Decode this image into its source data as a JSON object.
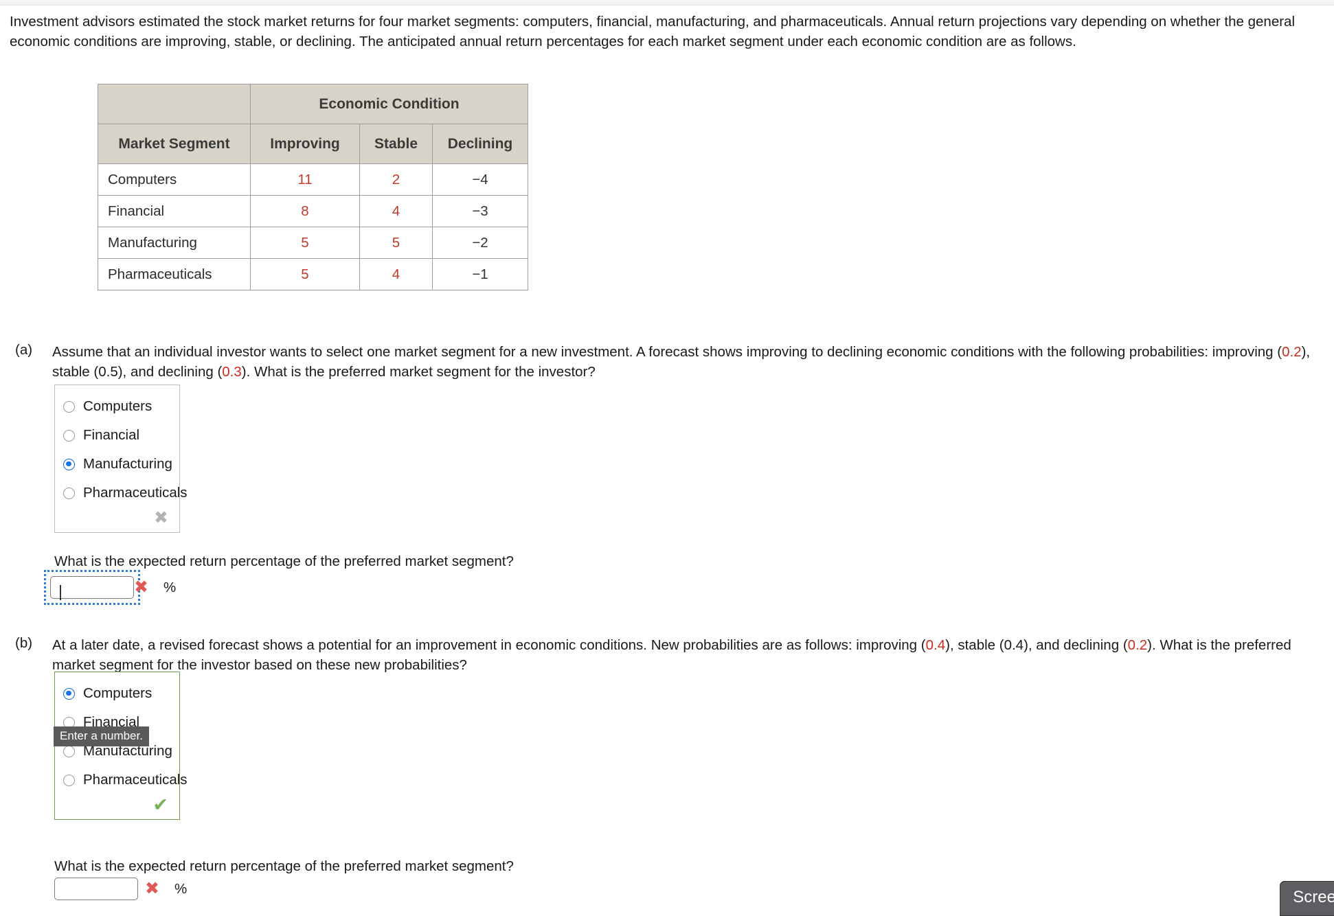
{
  "intro": {
    "paragraph": "Investment advisors estimated the stock market returns for four market segments: computers, financial, manufacturing, and pharmaceuticals. Annual return projections vary depending on whether the general economic conditions are improving, stable, or declining. The anticipated annual return percentages for each market segment under each economic condition are as follows."
  },
  "table": {
    "group_header": "Economic Condition",
    "col_segment": "Market Segment",
    "col_improving": "Improving",
    "col_stable": "Stable",
    "col_declining": "Declining",
    "rows": [
      {
        "segment": "Computers",
        "improving": "11",
        "stable": "2",
        "declining": "−4"
      },
      {
        "segment": "Financial",
        "improving": "8",
        "stable": "4",
        "declining": "−3"
      },
      {
        "segment": "Manufacturing",
        "improving": "5",
        "stable": "5",
        "declining": "−2"
      },
      {
        "segment": "Pharmaceuticals",
        "improving": "5",
        "stable": "4",
        "declining": "−1"
      }
    ]
  },
  "part_a": {
    "label": "(a)",
    "text_1": "Assume that an individual investor wants to select one market segment for a new investment. A forecast shows improving to declining economic conditions with the following",
    "text_2_pre": "probabilities: improving (",
    "prob_improving": "0.2",
    "text_2_mid1": "), stable (0.5), and declining (",
    "prob_declining": "0.3",
    "text_2_post": "). What is the preferred market segment for the investor?",
    "options": [
      "Computers",
      "Financial",
      "Manufacturing",
      "Pharmaceuticals"
    ],
    "selected": "Manufacturing",
    "box_mark": "✖",
    "box_mark_name": "incorrect-x-mark",
    "prompt": "What is the expected return percentage of the preferred market segment?",
    "input_value": "",
    "input_mark": "✖",
    "unit": "%"
  },
  "part_b": {
    "label": "(b)",
    "text_1_pre": "At a later date, a revised forecast shows a potential for an improvement in economic conditions. New probabilities are as follows: improving (",
    "prob_improving": "0.4",
    "text_1_mid": "), stable (0.4), and declining",
    "text_2_pre": "(",
    "prob_declining": "0.2",
    "text_2_post": "). What is the preferred market segment for the investor based on these new probabilities?",
    "options": [
      "Computers",
      "Financial",
      "Manufacturing",
      "Pharmaceuticals"
    ],
    "selected": "Computers",
    "box_mark": "✔",
    "box_mark_name": "correct-check-mark",
    "tooltip": "Enter a number.",
    "prompt": "What is the expected return percentage of the preferred market segment?",
    "input_value": "",
    "input_mark": "✖",
    "unit": "%"
  },
  "footer": {
    "screenshot_button": "Scree"
  },
  "colors": {
    "positive_value": "#c0392b",
    "probability_highlight": "#cc2b1e",
    "table_header_bg": "#d7d3c9",
    "radio_selected": "#1a73e8",
    "correct_green": "#74b457",
    "incorrect_red": "#e05a53",
    "focus_ring_blue": "#2f7bdc"
  }
}
